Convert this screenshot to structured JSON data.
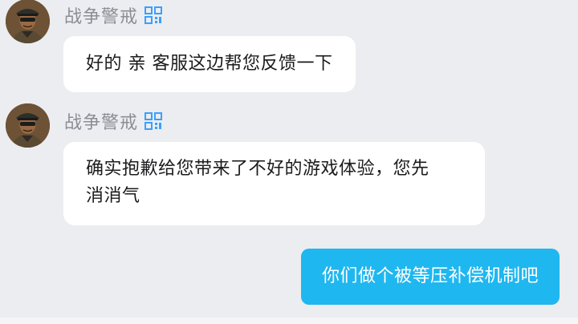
{
  "messages": [
    {
      "sender": "战争警戒",
      "text": "好的 亲 客服这边帮您反馈一下",
      "direction": "in"
    },
    {
      "sender": "战争警戒",
      "text_line1": "确实抱歉给您带来了不好的游戏体验，您先",
      "text_line2": "消消气",
      "direction": "in"
    },
    {
      "text": "你们做个被等压补偿机制吧",
      "direction": "out"
    }
  ],
  "colors": {
    "background": "#ebedf0",
    "incoming_bubble": "#ffffff",
    "outgoing_bubble": "#1fb7f0",
    "sender_name": "#8b8e94",
    "badge": "#3aa0ff"
  },
  "icons": {
    "avatar": "soldier-portrait-avatar",
    "badge": "qr-code-badge-icon"
  }
}
